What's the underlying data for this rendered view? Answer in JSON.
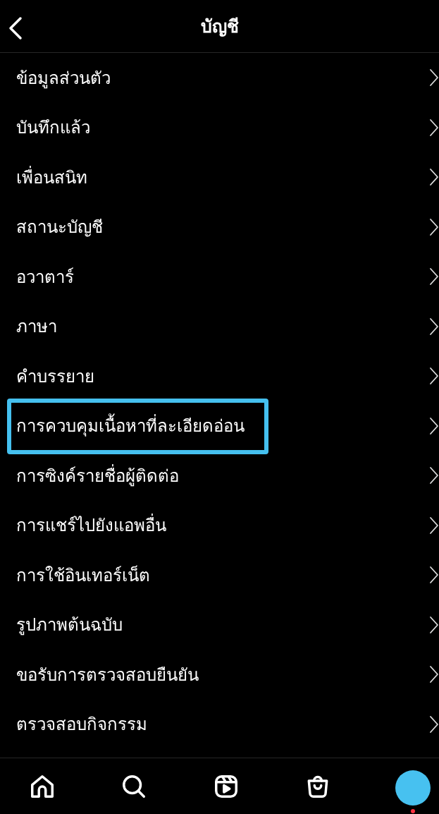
{
  "header": {
    "title": "บัญชี"
  },
  "settings_items": [
    {
      "label": "ข้อมูลส่วนตัว",
      "highlighted": false
    },
    {
      "label": "บันทึกแล้ว",
      "highlighted": false
    },
    {
      "label": "เพื่อนสนิท",
      "highlighted": false
    },
    {
      "label": "สถานะบัญชี",
      "highlighted": false
    },
    {
      "label": "อวาตาร์",
      "highlighted": false
    },
    {
      "label": "ภาษา",
      "highlighted": false
    },
    {
      "label": "คำบรรยาย",
      "highlighted": false
    },
    {
      "label": "การควบคุมเนื้อหาที่ละเอียดอ่อน",
      "highlighted": true
    },
    {
      "label": "การซิงค์รายชื่อผู้ติดต่อ",
      "highlighted": false
    },
    {
      "label": "การแชร์ไปยังแอพอื่น",
      "highlighted": false
    },
    {
      "label": "การใช้อินเทอร์เน็ต",
      "highlighted": false
    },
    {
      "label": "รูปภาพต้นฉบับ",
      "highlighted": false
    },
    {
      "label": "ขอรับการตรวจสอบยืนยัน",
      "highlighted": false
    },
    {
      "label": "ตรวจสอบกิจกรรม",
      "highlighted": false
    }
  ],
  "bottom_nav": [
    {
      "kind": "home"
    },
    {
      "kind": "search"
    },
    {
      "kind": "reels"
    },
    {
      "kind": "shop"
    },
    {
      "kind": "profile",
      "notification": true
    }
  ]
}
